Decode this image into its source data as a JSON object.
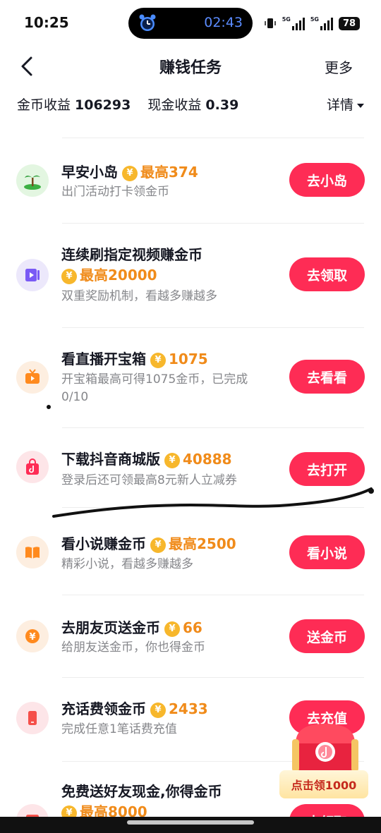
{
  "status_bar": {
    "time": "10:25",
    "timer": "02:43",
    "battery": "78",
    "signal_label": "5G"
  },
  "nav": {
    "title": "赚钱任务",
    "more": "更多"
  },
  "earnings": {
    "coin_label": "金币收益",
    "coin_value": "106293",
    "cash_label": "现金收益",
    "cash_value": "0.39",
    "detail": "详情"
  },
  "coin_symbol": "¥",
  "tasks": [
    {
      "title": "早安小岛",
      "reward": "最高374",
      "desc": "出门活动打卡领金币",
      "button": "去小岛",
      "icon": "island-icon",
      "icon_bg": "#e3f6e1"
    },
    {
      "title": "连续刷指定视频赚金币",
      "reward": "最高20000",
      "desc": "双重奖励机制，看越多赚越多",
      "button": "去领取",
      "icon": "video-icon",
      "icon_bg": "#ece8fb"
    },
    {
      "title": "看直播开宝箱",
      "reward": "1075",
      "desc": "开宝箱最高可得1075金币，已完成0/10",
      "button": "去看看",
      "icon": "tv-icon",
      "icon_bg": "#fdeee0"
    },
    {
      "title": "下载抖音商城版",
      "reward": "40888",
      "desc": "登录后还可领最高8元新人立减券",
      "button": "去打开",
      "icon": "shopping-bag-icon",
      "icon_bg": "#fde5e8"
    },
    {
      "title": "看小说赚金币",
      "reward": "最高2500",
      "desc": "精彩小说，看越多赚越多",
      "button": "看小说",
      "icon": "book-icon",
      "icon_bg": "#fdeee0"
    },
    {
      "title": "去朋友页送金币",
      "reward": "66",
      "desc": "给朋友送金币，你也得金币",
      "button": "送金币",
      "icon": "coin-gift-icon",
      "icon_bg": "#fdeee0"
    },
    {
      "title": "充话费领金币",
      "reward": "2433",
      "desc": "完成任意1笔话费充值",
      "button": "去充值",
      "icon": "phone-icon",
      "icon_bg": "#fde5e8"
    },
    {
      "title": "免费送好友现金,你得金币",
      "reward": "最高8000",
      "desc": "",
      "button": "去领取",
      "icon": "cash-envelope-icon",
      "icon_bg": "#fde5e8"
    }
  ],
  "floating": {
    "label": "点击领1000"
  },
  "colors": {
    "accent": "#fe2c55",
    "reward": "#f08b1a",
    "coin": "#f7b72c"
  }
}
